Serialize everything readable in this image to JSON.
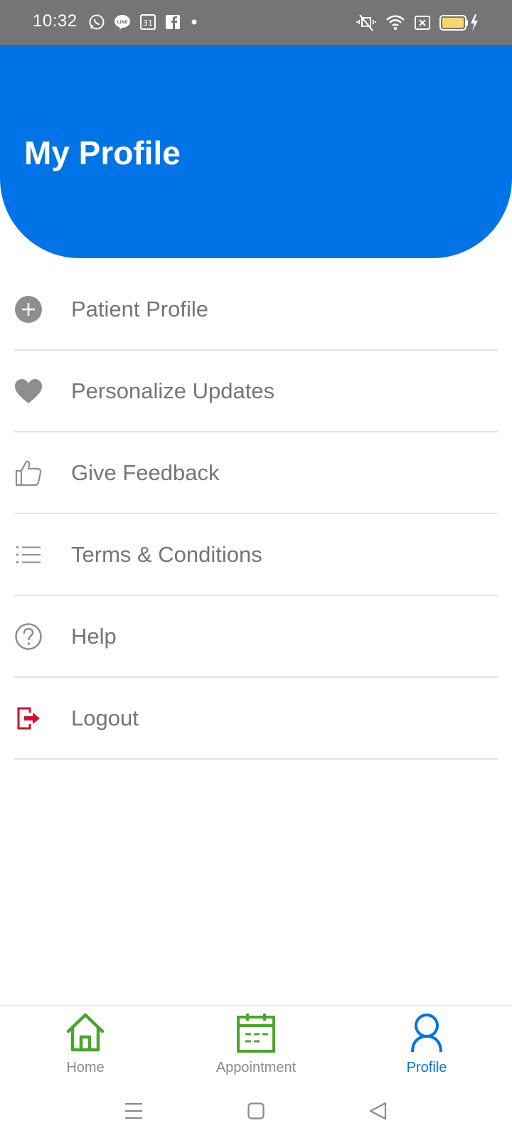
{
  "status_bar": {
    "time": "10:32",
    "left_icons": [
      "whatsapp-icon",
      "line-icon",
      "calendar-31-icon",
      "facebook-icon",
      "dot-icon"
    ],
    "calendar_day": "31",
    "right_icons": [
      "vibrate-mute-icon",
      "wifi-icon",
      "sim-x-icon",
      "battery-charging-icon"
    ]
  },
  "header": {
    "title": "My Profile",
    "background_color": "#0073e6"
  },
  "menu": {
    "items": [
      {
        "label": "Patient Profile",
        "icon": "plus-circle-icon"
      },
      {
        "label": "Personalize Updates",
        "icon": "heart-icon"
      },
      {
        "label": "Give Feedback",
        "icon": "thumbs-up-icon"
      },
      {
        "label": "Terms & Conditions",
        "icon": "list-icon"
      },
      {
        "label": "Help",
        "icon": "help-circle-icon"
      },
      {
        "label": "Logout",
        "icon": "logout-icon",
        "icon_color": "#d0102b"
      }
    ]
  },
  "bottom_nav": {
    "items": [
      {
        "label": "Home",
        "icon": "home-icon",
        "color": "#4aa52e"
      },
      {
        "label": "Appointment",
        "icon": "calendar-icon",
        "color": "#4aa52e"
      },
      {
        "label": "Profile",
        "icon": "person-icon",
        "color": "#0073e6",
        "active": true
      }
    ]
  },
  "system_nav": {
    "buttons": [
      "menu-icon",
      "home-square-icon",
      "back-triangle-icon"
    ]
  }
}
